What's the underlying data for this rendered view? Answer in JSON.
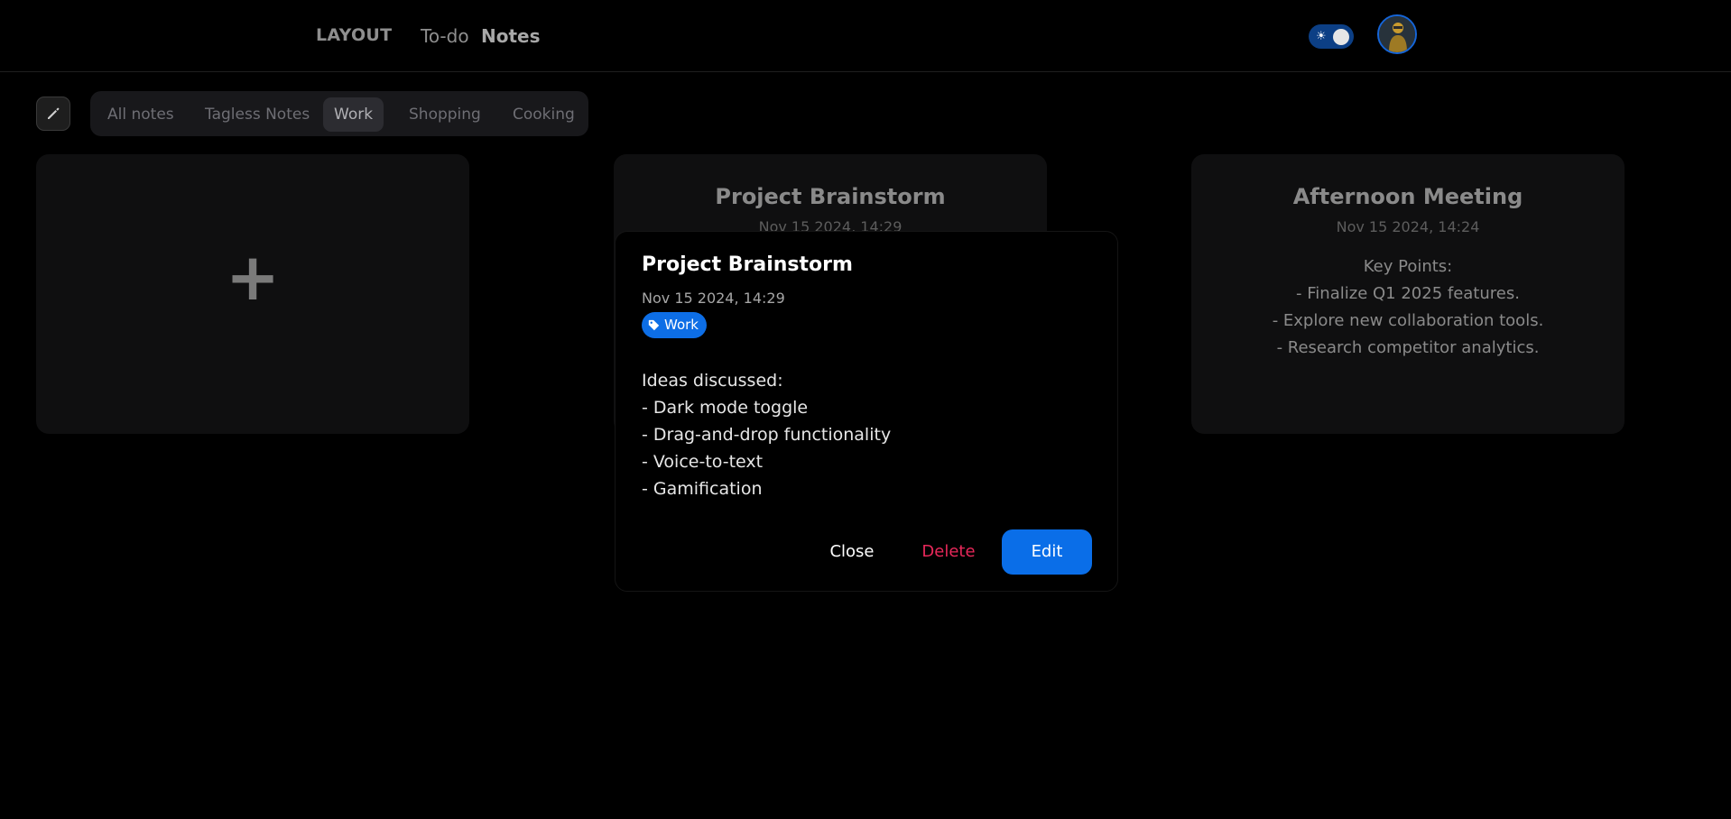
{
  "navbar": {
    "brand": "LAYOUT",
    "links": [
      {
        "label": "To-do",
        "active": false
      },
      {
        "label": "Notes",
        "active": true
      }
    ],
    "theme_toggle_icon": "sun-icon",
    "avatar_icon": "user-avatar"
  },
  "toolbar": {
    "edit_icon": "pencil-icon",
    "tabs": [
      {
        "label": "All notes",
        "active": false
      },
      {
        "label": "Tagless Notes",
        "active": false
      },
      {
        "label": "Work",
        "active": true
      },
      {
        "label": "Shopping",
        "active": false
      },
      {
        "label": "Cooking",
        "active": false
      }
    ]
  },
  "cards": {
    "add": {
      "symbol": "+"
    },
    "project": {
      "title": "Project Brainstorm",
      "date": "Nov 15 2024, 14:29"
    },
    "meeting": {
      "title": "Afternoon Meeting",
      "date": "Nov 15 2024, 14:24",
      "lines": [
        "Key Points:",
        "- Finalize Q1 2025 features.",
        "- Explore new collaboration tools.",
        "- Research competitor analytics."
      ]
    }
  },
  "modal": {
    "title": "Project Brainstorm",
    "date": "Nov 15 2024, 14:29",
    "tag": "Work",
    "lines": [
      "Ideas discussed:",
      "- Dark mode toggle",
      "- Drag-and-drop functionality",
      "- Voice-to-text",
      "- Gamification"
    ],
    "buttons": {
      "close": "Close",
      "delete": "Delete",
      "edit": "Edit"
    }
  },
  "colors": {
    "accent": "#0a6ee8",
    "danger": "#e8285a",
    "background": "#000000"
  }
}
